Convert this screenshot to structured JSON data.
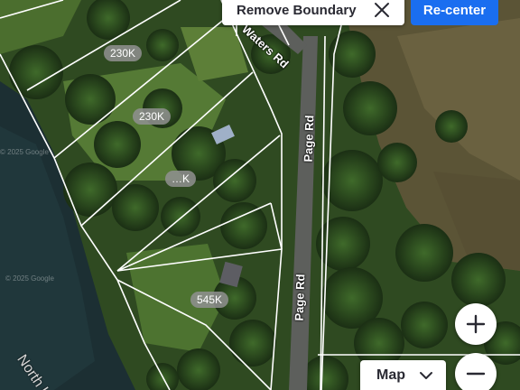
{
  "map": {
    "price_labels": [
      "230K",
      "230K",
      "…K",
      "545K"
    ],
    "roads": [
      "Waters Rd",
      "Page Rd",
      "Page Rd"
    ],
    "water_label": "North U",
    "watermark": "© 2025 Google"
  },
  "controls": {
    "remove_boundary_label": "Remove Boundary",
    "close_icon": "close-icon",
    "recenter_label": "Re-center",
    "map_type_label": "Map",
    "map_type_icon": "chevron-down-icon",
    "zoom_in_icon": "plus-icon",
    "zoom_out_icon": "minus-icon"
  },
  "colors": {
    "recenter_bg": "#1a6ef0",
    "parcel_line": "#ffffff",
    "price_tag_bg": "#919191"
  }
}
